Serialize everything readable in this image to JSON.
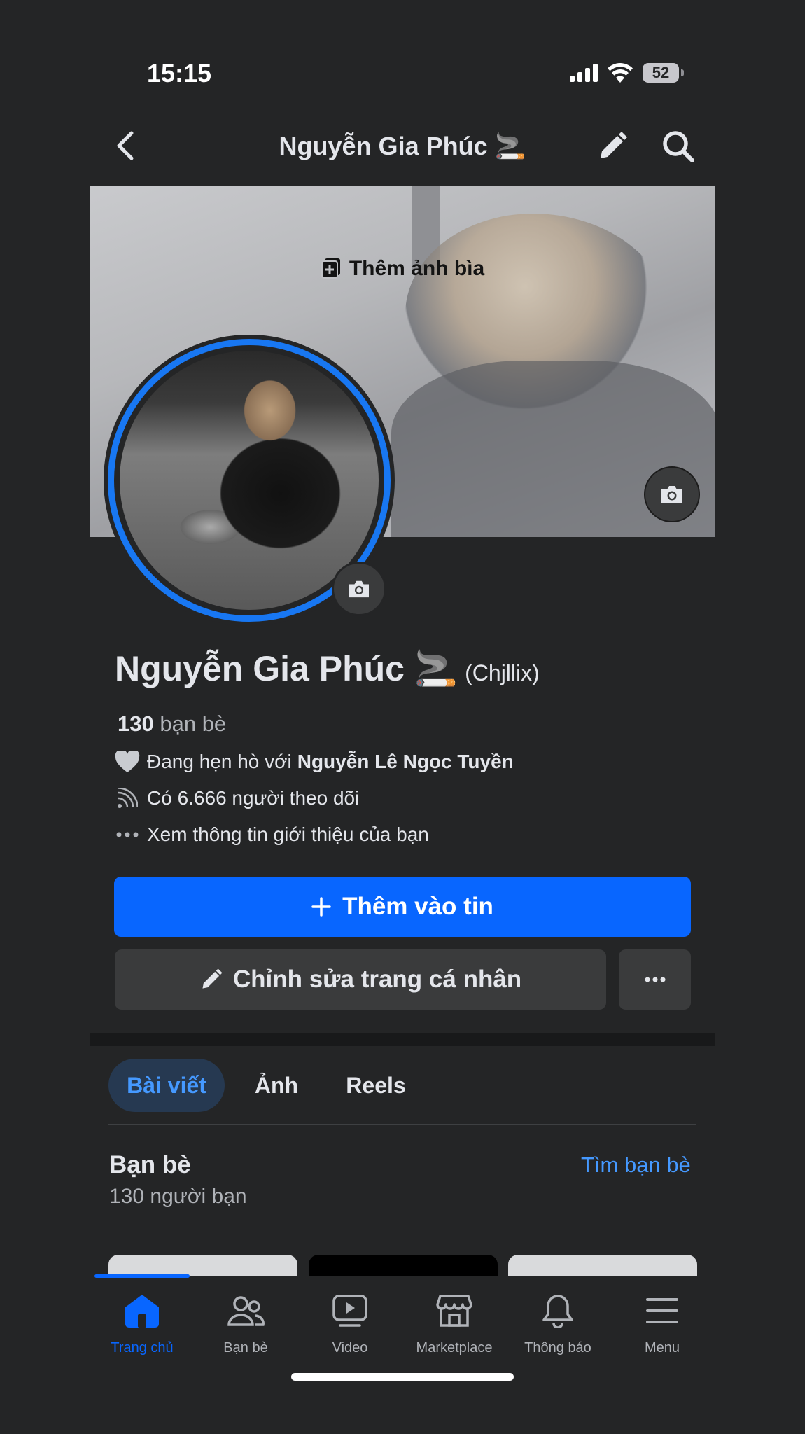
{
  "status_bar": {
    "time": "15:15",
    "battery": "52"
  },
  "header": {
    "title": "Nguyễn Gia Phúc 🚬"
  },
  "cover": {
    "add_cover_label": "Thêm ảnh bìa"
  },
  "profile": {
    "name": "Nguyễn Gia Phúc 🚬",
    "nickname": "(Chjllix)",
    "friends_count": "130",
    "friends_label": "bạn bè",
    "relationship_prefix": "Đang hẹn hò với",
    "relationship_partner": "Nguyễn Lê Ngọc Tuyền",
    "followers": "Có 6.666 người theo dõi",
    "about_link": "Xem thông tin giới thiệu của bạn"
  },
  "actions": {
    "add_to_story": "Thêm vào tin",
    "edit_profile": "Chỉnh sửa trang cá nhân"
  },
  "tabs": [
    {
      "label": "Bài viết",
      "active": true
    },
    {
      "label": "Ảnh",
      "active": false
    },
    {
      "label": "Reels",
      "active": false
    }
  ],
  "friends_section": {
    "title": "Bạn bè",
    "subtitle": "130 người bạn",
    "find_link": "Tìm bạn bè"
  },
  "bottom_nav": [
    {
      "label": "Trang chủ",
      "icon": "home-icon",
      "active": true
    },
    {
      "label": "Bạn bè",
      "icon": "friends-icon",
      "active": false
    },
    {
      "label": "Video",
      "icon": "video-icon",
      "active": false
    },
    {
      "label": "Marketplace",
      "icon": "marketplace-icon",
      "active": false
    },
    {
      "label": "Thông báo",
      "icon": "bell-icon",
      "active": false
    },
    {
      "label": "Menu",
      "icon": "menu-icon",
      "active": false
    }
  ],
  "colors": {
    "background": "#242526",
    "accent": "#0866ff",
    "link": "#4599ff",
    "button_secondary": "#3a3b3c"
  }
}
